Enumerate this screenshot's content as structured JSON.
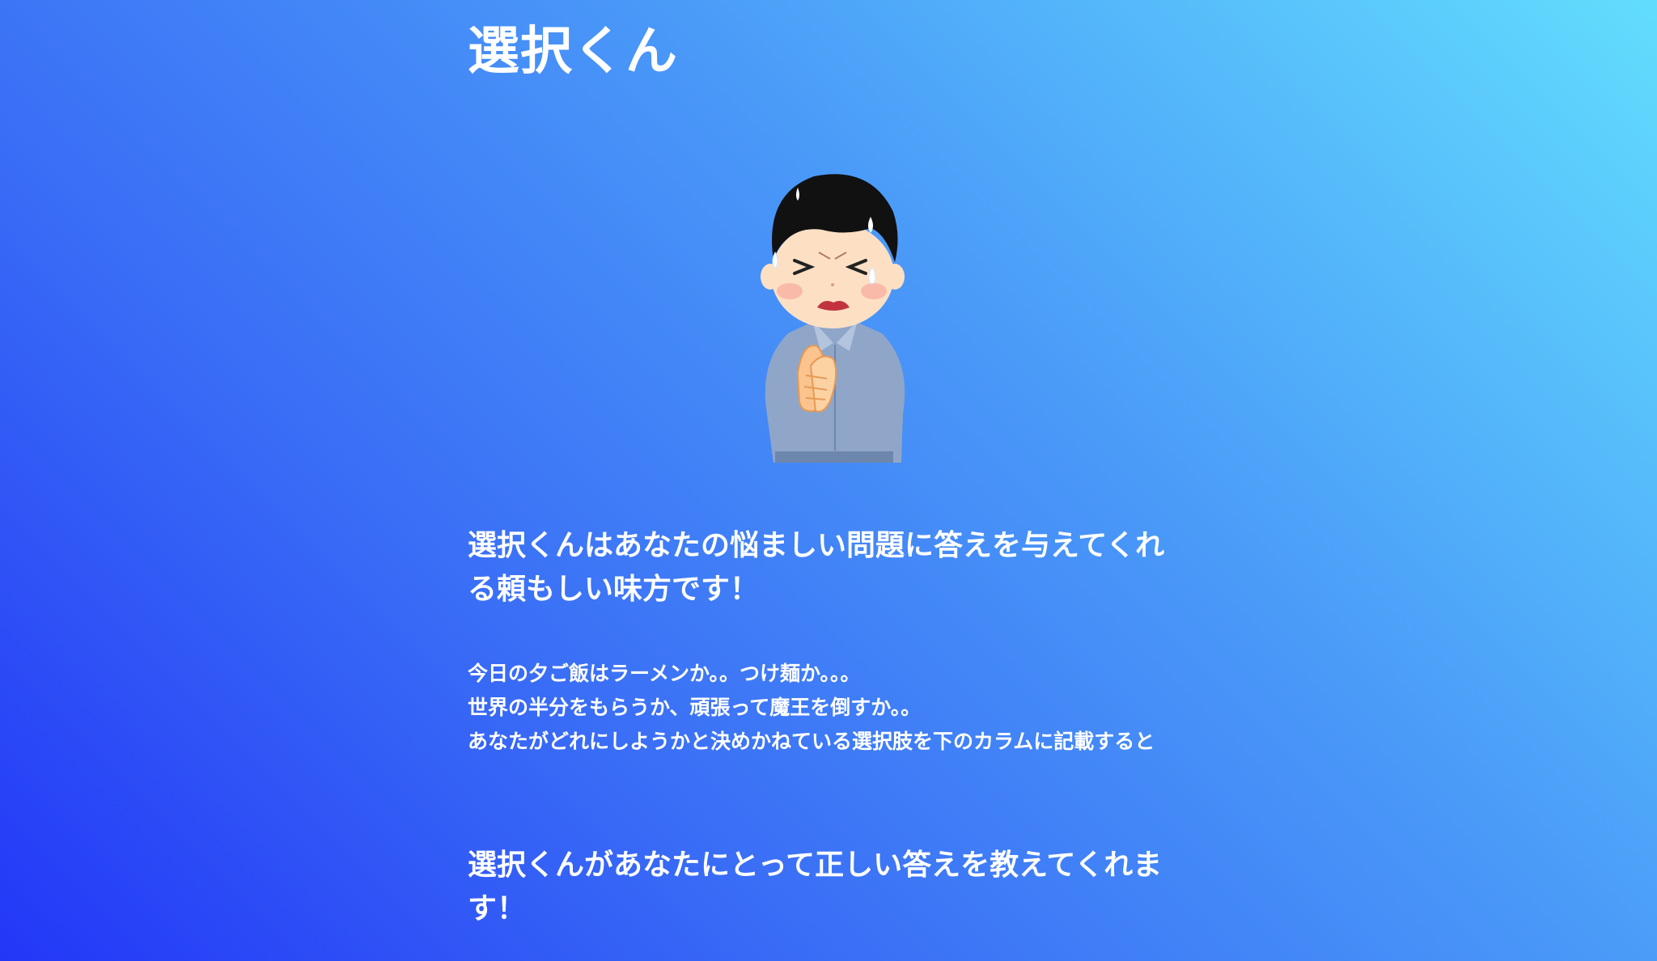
{
  "app": {
    "title": "選択くん"
  },
  "hero": {
    "illustration": "worried-praying-man-icon"
  },
  "content": {
    "tagline": "選択くんはあなたの悩ましい問題に答えを与えてくれる頼もしい味方です！",
    "description_lines": [
      "今日の夕ご飯はラーメンか。。つけ麺か。。。",
      "世界の半分をもらうか、頑張って魔王を倒すか。。",
      "あなたがどれにしようかと決めかねている選択肢を下のカラムに記載すると"
    ],
    "closing": "選択くんがあなたにとって正しい答えを教えてくれます！"
  },
  "colors": {
    "gradient_top_right": "#62ddfd",
    "gradient_bottom_left": "#2337f7",
    "text": "#ffffff",
    "shirt": "#8fa6c9",
    "hair": "#111111",
    "skin": "#fde0c4"
  }
}
